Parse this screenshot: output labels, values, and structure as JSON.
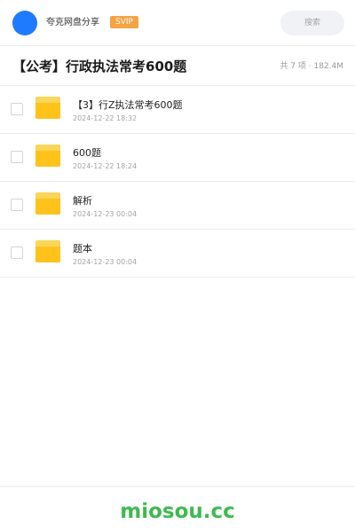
{
  "header": {
    "username": "夸克网盘分享",
    "badge": "SVIP",
    "search_placeholder": "搜索"
  },
  "folder": {
    "title": "【公考】行政执法常考600题",
    "meta": "共 7 项 · 182.4M"
  },
  "items": [
    {
      "name": "【3】行Z执法常考600题",
      "date": "2024-12-22 18:32"
    },
    {
      "name": "600题",
      "date": "2024-12-22 18:24"
    },
    {
      "name": "解析",
      "date": "2024-12-23 00:04"
    },
    {
      "name": "题本",
      "date": "2024-12-23 00:04"
    }
  ],
  "footer": {
    "brand": "miosou.cc",
    "brand_color": "#3fb950"
  },
  "colors": {
    "accent_blue": "#1e7bff",
    "svip_orange": "#f5a445",
    "folder_yellow": "#ffc21a"
  }
}
